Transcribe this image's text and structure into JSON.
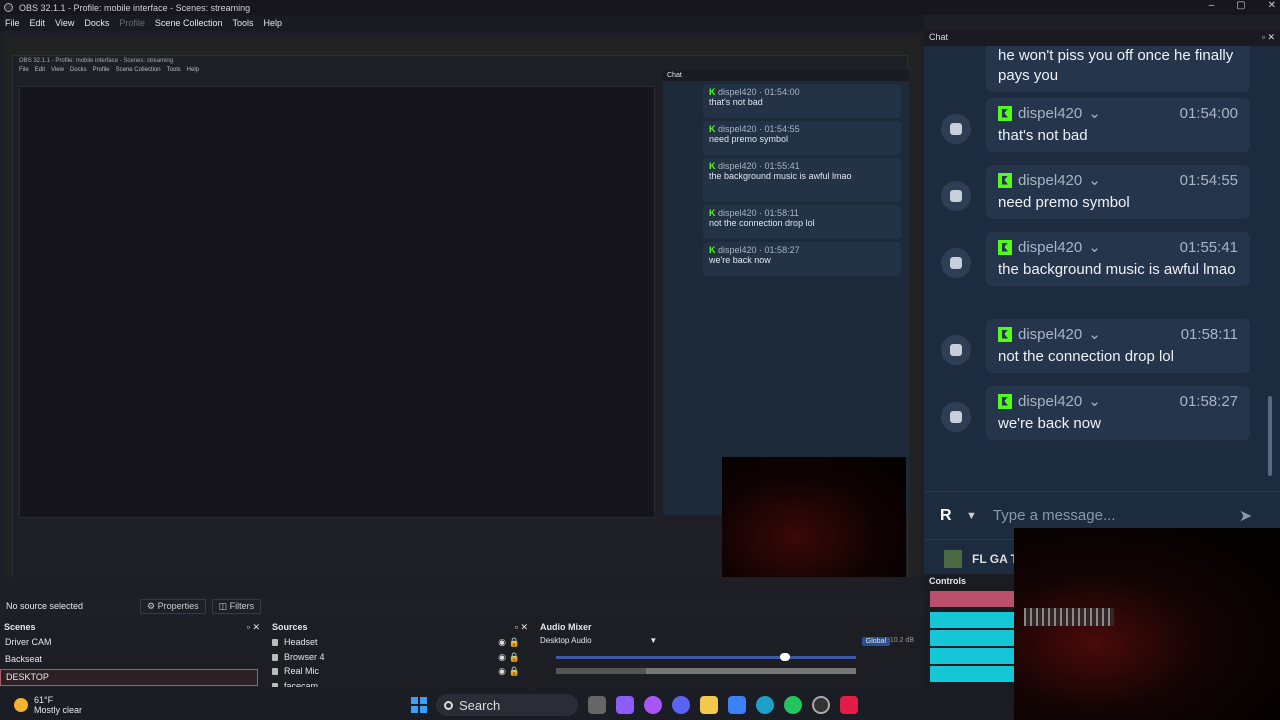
{
  "window": {
    "title": "OBS 32.1.1 - Profile: mobile interface - Scenes: streaming",
    "controls": [
      "–",
      "▢",
      "✕"
    ]
  },
  "menu": {
    "items": [
      "File",
      "Edit",
      "View",
      "Docks",
      "Profile",
      "Scene Collection",
      "Tools",
      "Help"
    ]
  },
  "nested": {
    "title": "OBS 32.1.1 - Profile: mobile interface - Scenes: streaming",
    "chat_label": "Chat",
    "messages": [
      {
        "user": "dispel420",
        "time": "01:54:00",
        "text": "that's not bad"
      },
      {
        "user": "dispel420",
        "time": "01:54:55",
        "text": "need premo symbol"
      },
      {
        "user": "dispel420",
        "time": "01:55:41",
        "text": "the background music is awful lmao"
      },
      {
        "user": "dispel420",
        "time": "01:58:11",
        "text": "not the connection drop lol"
      },
      {
        "user": "dispel420",
        "time": "01:58:27",
        "text": "we're back now"
      }
    ]
  },
  "chat": {
    "title": "Chat",
    "partial_message": "he won't piss you off once he finally pays you",
    "messages": [
      {
        "user": "dispel420",
        "time": "01:54:00",
        "text": "that's not bad"
      },
      {
        "user": "dispel420",
        "time": "01:54:55",
        "text": "need premo symbol"
      },
      {
        "user": "dispel420",
        "time": "01:55:41",
        "text": "the background music is awful lmao"
      },
      {
        "user": "dispel420",
        "time": "01:58:11",
        "text": "not the connection drop lol"
      },
      {
        "user": "dispel420",
        "time": "01:58:27",
        "text": "we're back now"
      }
    ],
    "input_placeholder": "Type a message...",
    "account_letter": "R",
    "channel": "FL GA T"
  },
  "controls": {
    "title": "Controls"
  },
  "status": {
    "no_source": "No source selected",
    "properties": "Properties",
    "filters": "Filters"
  },
  "scenes": {
    "title": "Scenes",
    "items": [
      "Driver CAM",
      "Backseat",
      "DESKTOP"
    ],
    "active": "DESKTOP"
  },
  "sources": {
    "title": "Sources",
    "items": [
      "Headset",
      "Browser 4",
      "Real Mic",
      "facecam"
    ]
  },
  "mixer": {
    "title": "Audio Mixer",
    "device": "Desktop Audio",
    "global": "Global",
    "db": "-10.2 dB"
  },
  "taskbar": {
    "temp": "61°F",
    "condition": "Mostly clear",
    "search": "Search"
  },
  "colors": {
    "kick_green": "#53fc18",
    "chat_bg": "#1d2b3e",
    "control_cyan": "#15c6d6"
  }
}
